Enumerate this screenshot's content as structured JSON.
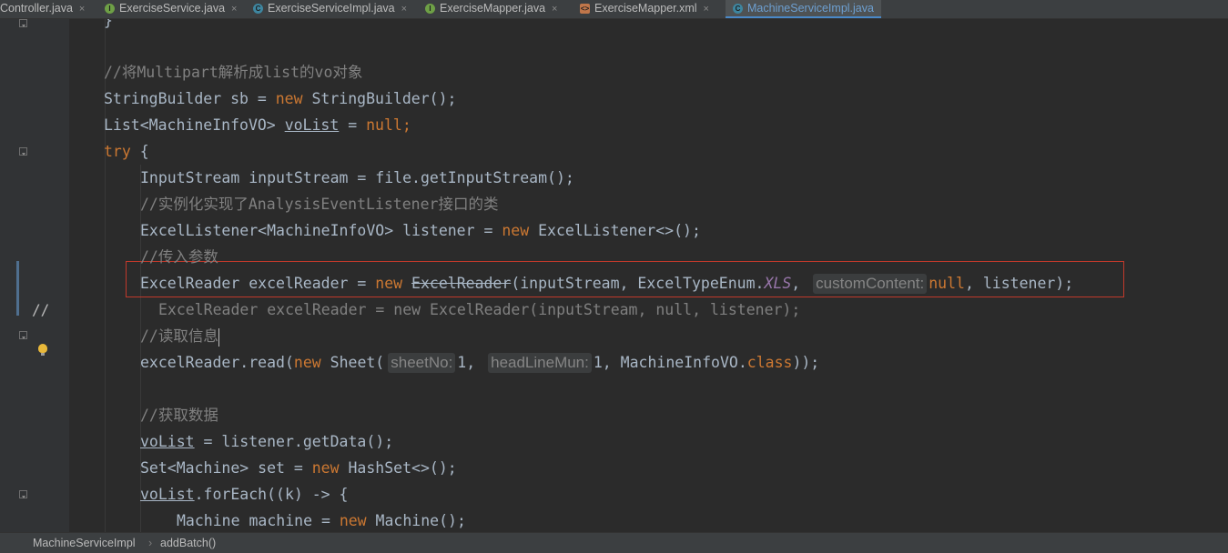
{
  "tabs": [
    {
      "label": "Controller.java",
      "icon": "none"
    },
    {
      "label": "ExerciseService.java",
      "icon": "interface-icon"
    },
    {
      "label": "ExerciseServiceImpl.java",
      "icon": "class-icon"
    },
    {
      "label": "ExerciseMapper.java",
      "icon": "interface-icon"
    },
    {
      "label": "ExerciseMapper.xml",
      "icon": "xml-icon"
    },
    {
      "label": "MachineServiceImpl.java",
      "icon": "class-icon",
      "active": true
    }
  ],
  "tab_close_glyph": "×",
  "gutter": {
    "comment_marker": "//"
  },
  "code": {
    "l0": "}",
    "l2": "//将Multipart解析成list的vo对象",
    "l3a": "StringBuilder sb = ",
    "l3b": "new",
    "l3c": " StringBuilder();",
    "l4a": "List<MachineInfoVO> ",
    "l4b": "voList",
    "l4c": " = ",
    "l4d": "null",
    "l4e": ";",
    "l5a": "try",
    "l5b": " {",
    "l6": "InputStream inputStream = file.getInputStream();",
    "l7": "//实例化实现了AnalysisEventListener接口的类",
    "l8a": "ExcelListener<MachineInfoVO> listener = ",
    "l8b": "new",
    "l8c": " ExcelListener<>();",
    "l9": "//传入参数",
    "l10a": "ExcelReader excelReader = ",
    "l10b": "new",
    "l10c": "ExcelReader",
    "l10d": "(inputStream, ExcelTypeEnum.",
    "l10e": "XLS",
    "l10f": ",",
    "l10hint": "customContent:",
    "l10g": "null",
    "l10h": ", listener);",
    "l11": "ExcelReader excelReader = new ExcelReader(inputStream, null, listener);",
    "l12": "//读取信息",
    "l13a": "excelReader.read(",
    "l13b": "new",
    "l13c": " Sheet(",
    "l13hint1": "sheetNo:",
    "l13d": "1,",
    "l13hint2": "headLineMun:",
    "l13e": "1, MachineInfoVO.",
    "l13f": "class",
    "l13g": "));",
    "l15": "//获取数据",
    "l16a": "voList",
    "l16b": " = listener.getData();",
    "l17a": "Set<Machine> set = ",
    "l17b": "new",
    "l17c": " HashSet<>();",
    "l18a": "voList",
    "l18b": ".forEach((k) -> {",
    "l19a": "Machine machine = ",
    "l19b": "new",
    "l19c": " Machine();"
  },
  "breadcrumb": {
    "class": "MachineServiceImpl",
    "separator": "›",
    "method": "addBatch()"
  },
  "colors": {
    "background": "#2b2b2b",
    "keyword": "#cc7832",
    "comment": "#808080",
    "text": "#a9b7c6",
    "constant": "#9876aa",
    "highlight_box": "#c0392b"
  }
}
